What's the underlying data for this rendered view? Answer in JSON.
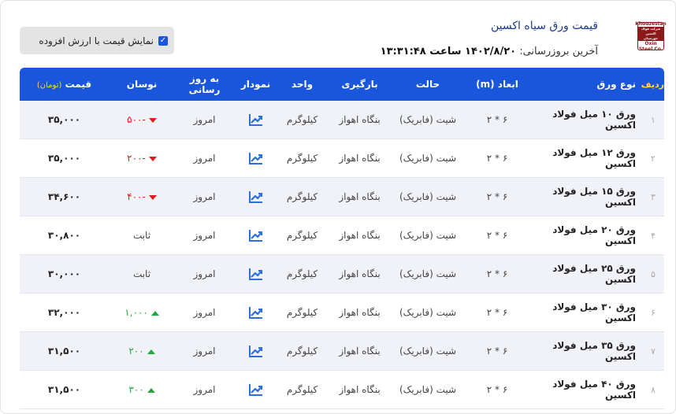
{
  "header": {
    "title": "قیمت ورق سیاه اکسین",
    "last_update_label": "آخرین بروزرسانی:",
    "last_update_value": "۱۴۰۲/۸/۲۰ ساعت ۱۳:۳۱:۴۸",
    "logo": {
      "top": "Khouzestan",
      "middle": "شرکت فولاد اکسین خوزستان",
      "bottom": "Oxin Steel Co."
    }
  },
  "vat_toggle": {
    "label": "نمایش قیمت با ارزش افزوده",
    "checked": true
  },
  "table": {
    "headers": {
      "index": "ردیف",
      "type": "نوع ورق",
      "dimension": "ابعاد (m)",
      "state": "حالت",
      "loading": "بارگیری",
      "unit": "واحد",
      "chart": "نمودار",
      "update": "به روز رسانی",
      "change": "نوسان",
      "price": "قیمت",
      "price_unit": "(تومان)"
    },
    "rows": [
      {
        "index": "۱",
        "type": "ورق ۱۰ میل فولاد اکسین",
        "dimension": "۶ * ۲",
        "state": "شیت (فابریک)",
        "loading": "بنگاه اهواز",
        "unit": "کیلوگرم",
        "update": "امروز",
        "change": "-۵۰۰",
        "trend": "down",
        "price": "۳۵,۰۰۰"
      },
      {
        "index": "۲",
        "type": "ورق ۱۲ میل فولاد اکسین",
        "dimension": "۶ * ۲",
        "state": "شیت (فابریک)",
        "loading": "بنگاه اهواز",
        "unit": "کیلوگرم",
        "update": "امروز",
        "change": "-۲۰۰",
        "trend": "down",
        "price": "۳۵,۰۰۰"
      },
      {
        "index": "۳",
        "type": "ورق ۱۵ میل فولاد اکسین",
        "dimension": "۶ * ۲",
        "state": "شیت (فابریک)",
        "loading": "بنگاه اهواز",
        "unit": "کیلوگرم",
        "update": "امروز",
        "change": "-۴۰۰",
        "trend": "down",
        "price": "۳۴,۶۰۰"
      },
      {
        "index": "۴",
        "type": "ورق ۲۰ میل فولاد اکسین",
        "dimension": "۶ * ۲",
        "state": "شیت (فابریک)",
        "loading": "بنگاه اهواز",
        "unit": "کیلوگرم",
        "update": "امروز",
        "change": "ثابت",
        "trend": "flat",
        "price": "۳۰,۸۰۰"
      },
      {
        "index": "۵",
        "type": "ورق ۲۵ میل فولاد اکسین",
        "dimension": "۶ * ۲",
        "state": "شیت (فابریک)",
        "loading": "بنگاه اهواز",
        "unit": "کیلوگرم",
        "update": "امروز",
        "change": "ثابت",
        "trend": "flat",
        "price": "۳۰,۰۰۰"
      },
      {
        "index": "۶",
        "type": "ورق ۳۰ میل فولاد اکسین",
        "dimension": "۶ * ۲",
        "state": "شیت (فابریک)",
        "loading": "بنگاه اهواز",
        "unit": "کیلوگرم",
        "update": "امروز",
        "change": "۱,۰۰۰",
        "trend": "up",
        "price": "۳۲,۰۰۰"
      },
      {
        "index": "۷",
        "type": "ورق ۳۵ میل فولاد اکسین",
        "dimension": "۶ * ۲",
        "state": "شیت (فابریک)",
        "loading": "بنگاه اهواز",
        "unit": "کیلوگرم",
        "update": "امروز",
        "change": "۲۰۰",
        "trend": "up",
        "price": "۳۱,۵۰۰"
      },
      {
        "index": "۸",
        "type": "ورق ۴۰ میل فولاد اکسین",
        "dimension": "۶ * ۲",
        "state": "شیت (فابریک)",
        "loading": "بنگاه اهواز",
        "unit": "کیلوگرم",
        "update": "امروز",
        "change": "۳۰۰",
        "trend": "up",
        "price": "۳۱,۵۰۰"
      }
    ]
  },
  "colors": {
    "header_bg": "#1a56db",
    "header_index": "#ffd54a",
    "down": "#e01b1b",
    "up": "#22a83a",
    "chart_icon": "#2b6fe0"
  },
  "icons": {
    "chart": "trend-chart-icon",
    "checkbox": "checkbox-checked-icon",
    "down": "triangle-down-icon",
    "up": "triangle-up-icon"
  }
}
